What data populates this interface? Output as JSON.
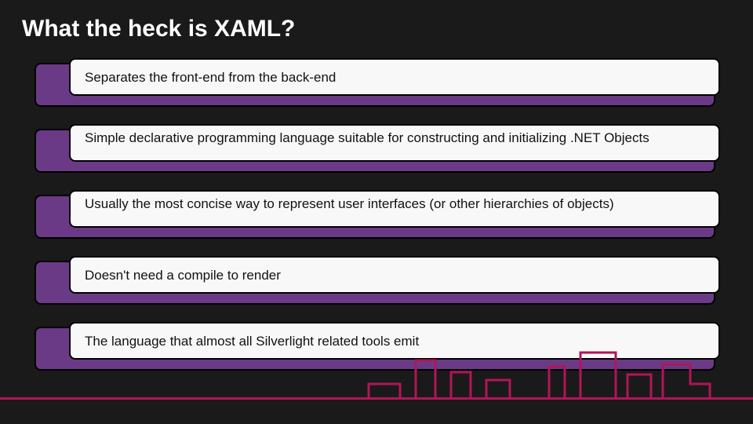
{
  "title": "What the heck is XAML?",
  "items": [
    "Separates the front-end from the back-end",
    "Simple declarative programming language suitable for constructing and initializing .NET Objects",
    "Usually the most concise way to represent user interfaces (or other hierarchies of objects)",
    "Doesn't need a compile to render",
    "The language that almost all Silverlight related tools emit"
  ],
  "colors": {
    "accent_purple": "#6b3a86",
    "accent_magenta": "#b01657",
    "background": "#1a1a1a",
    "card": "#f9f8f8"
  }
}
